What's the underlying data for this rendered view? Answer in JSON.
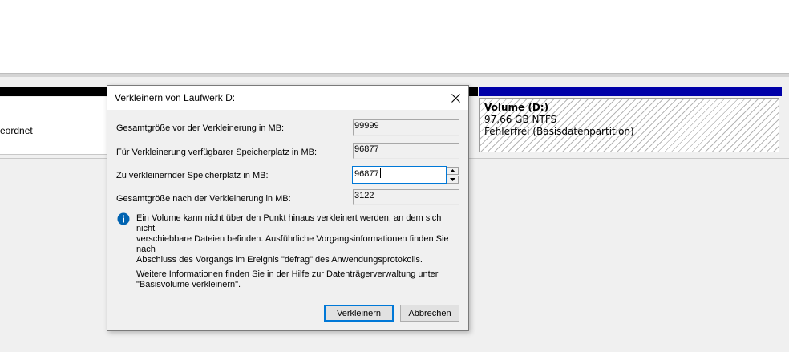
{
  "background": {
    "left_partition_label": "eordnet",
    "volume": {
      "name": "Volume  (D:)",
      "size": "97,66 GB NTFS",
      "status": "Fehlerfrei (Basisdatenpartition)"
    }
  },
  "dialog": {
    "title": "Verkleinern von Laufwerk D:",
    "fields": [
      {
        "label": "Gesamtgröße vor der Verkleinerung in MB:",
        "value": "99999"
      },
      {
        "label": "Für Verkleinerung verfügbarer Speicherplatz in MB:",
        "value": "96877"
      },
      {
        "label": "Zu verkleinernder Speicherplatz in MB:",
        "value": "96877"
      },
      {
        "label": "Gesamtgröße nach der Verkleinerung in MB:",
        "value": "3122"
      }
    ],
    "info_lines": [
      "Ein Volume kann nicht über den Punkt hinaus verkleinert werden, an dem sich nicht",
      "verschiebbare Dateien befinden. Ausführliche Vorgangsinformationen finden Sie nach",
      "Abschluss des Vorgangs im Ereignis \"defrag\" des Anwendungsprotokolls."
    ],
    "help_lines": [
      "Weitere Informationen finden Sie in der Hilfe zur Datenträgerverwaltung unter",
      "\"Basisvolume verkleinern\"."
    ],
    "buttons": {
      "shrink": "Verkleinern",
      "cancel": "Abbrechen"
    }
  },
  "icons": {
    "close": "close-icon",
    "info": "info-icon",
    "spin_up": "chevron-up-icon",
    "spin_down": "chevron-down-icon"
  },
  "colors": {
    "accent": "#0078d7",
    "info": "#0063b1",
    "primary_bar": "#0000a8"
  }
}
